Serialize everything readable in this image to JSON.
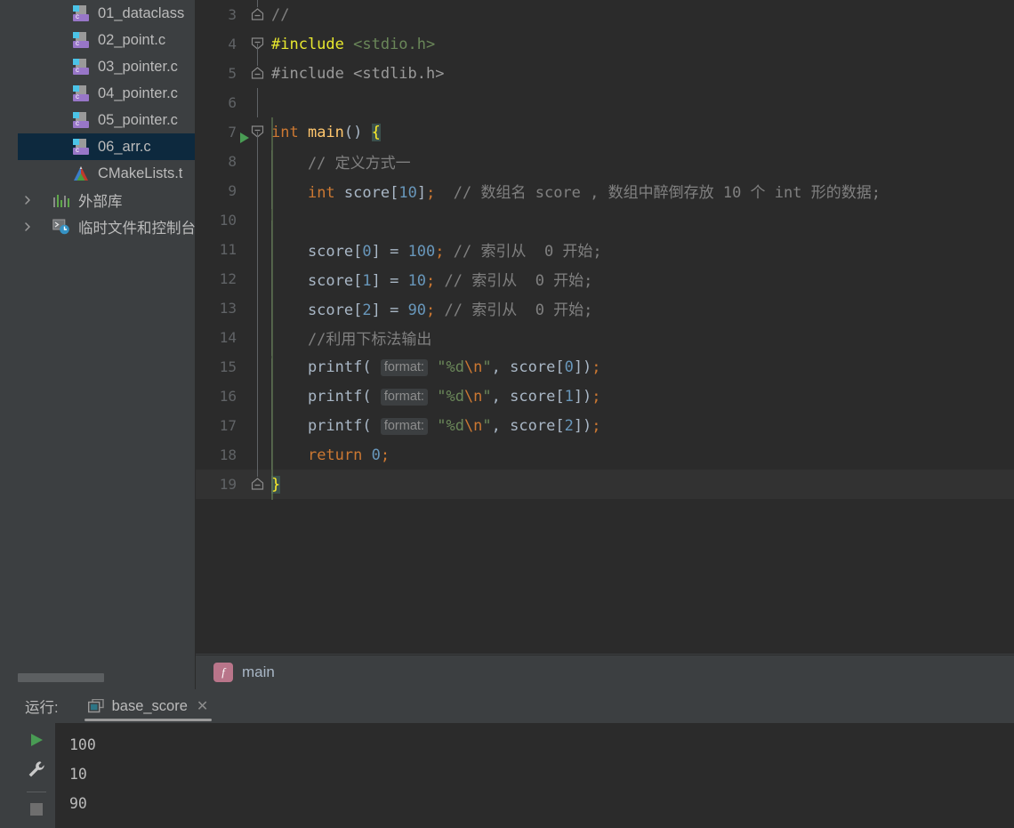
{
  "project_tree": {
    "name": "project-tree",
    "items": [
      {
        "label": "01_dataclass",
        "icon": "c-file-icon",
        "type": "file",
        "selected": false,
        "indent": "file"
      },
      {
        "label": "02_point.c",
        "icon": "c-file-icon",
        "type": "file",
        "selected": false,
        "indent": "file"
      },
      {
        "label": "03_pointer.c",
        "icon": "c-file-icon",
        "type": "file",
        "selected": false,
        "indent": "file"
      },
      {
        "label": "04_pointer.c",
        "icon": "c-file-icon",
        "type": "file",
        "selected": false,
        "indent": "file"
      },
      {
        "label": "05_pointer.c",
        "icon": "c-file-icon",
        "type": "file",
        "selected": false,
        "indent": "file"
      },
      {
        "label": "06_arr.c",
        "icon": "c-file-icon",
        "type": "file",
        "selected": true,
        "indent": "file"
      },
      {
        "label": "CMakeLists.t",
        "icon": "cmake-file-icon",
        "type": "file",
        "selected": false,
        "indent": "file"
      },
      {
        "label": "外部库",
        "icon": "external-libraries-icon",
        "type": "node",
        "selected": false,
        "indent": "node"
      },
      {
        "label": "临时文件和控制台",
        "icon": "scratches-consoles-icon",
        "type": "node",
        "selected": false,
        "indent": "node"
      }
    ],
    "selection_color": "#0d293e"
  },
  "editor": {
    "name": "code-editor",
    "first_visible_line": 3,
    "current_line": 19,
    "run_marker_line": 7,
    "lines": [
      {
        "num": "3",
        "segments": [
          {
            "t": "//",
            "c": "t-com"
          }
        ],
        "fold": "end",
        "indent": false
      },
      {
        "num": "4",
        "segments": [
          {
            "t": "#include ",
            "c": "t-inc-hl"
          },
          {
            "t": "<stdio.h>",
            "c": "t-hdr"
          }
        ],
        "fold": "start",
        "indent": false
      },
      {
        "num": "5",
        "segments": [
          {
            "t": "#include ",
            "c": "t-inc"
          },
          {
            "t": "<stdlib.h>",
            "c": "t-hdr-g"
          }
        ],
        "fold": "end",
        "indent": false
      },
      {
        "num": "6",
        "segments": [],
        "fold": "none",
        "indent": false
      },
      {
        "num": "7",
        "segments": [
          {
            "t": "int ",
            "c": "t-kw"
          },
          {
            "t": "main",
            "c": "t-fn"
          },
          {
            "t": "()",
            "c": "t-paren"
          },
          {
            "t": " ",
            "c": "t-def"
          },
          {
            "t": "{",
            "c": "t-brace-hl"
          }
        ],
        "fold": "start",
        "indent": false
      },
      {
        "num": "8",
        "segments": [
          {
            "t": "    // 定义方式一",
            "c": "t-com"
          }
        ],
        "fold": "none",
        "indent": true
      },
      {
        "num": "9",
        "segments": [
          {
            "t": "    ",
            "c": "t-def"
          },
          {
            "t": "int",
            "c": "t-kw"
          },
          {
            "t": " score[",
            "c": "t-def"
          },
          {
            "t": "10",
            "c": "t-num"
          },
          {
            "t": "]",
            "c": "t-def"
          },
          {
            "t": ";",
            "c": "t-esc"
          },
          {
            "t": "  // 数组名 score , 数组中醉倒存放 10 个 int 形的数据;",
            "c": "t-com"
          }
        ],
        "fold": "none",
        "indent": true
      },
      {
        "num": "10",
        "segments": [],
        "fold": "none",
        "indent": true
      },
      {
        "num": "11",
        "segments": [
          {
            "t": "    score[",
            "c": "t-def"
          },
          {
            "t": "0",
            "c": "t-num"
          },
          {
            "t": "] = ",
            "c": "t-def"
          },
          {
            "t": "100",
            "c": "t-num"
          },
          {
            "t": ";",
            "c": "t-esc"
          },
          {
            "t": " // 索引从  0 开始;",
            "c": "t-com"
          }
        ],
        "fold": "none",
        "indent": true
      },
      {
        "num": "12",
        "segments": [
          {
            "t": "    score[",
            "c": "t-def"
          },
          {
            "t": "1",
            "c": "t-num"
          },
          {
            "t": "] = ",
            "c": "t-def"
          },
          {
            "t": "10",
            "c": "t-num"
          },
          {
            "t": ";",
            "c": "t-esc"
          },
          {
            "t": " // 索引从  0 开始;",
            "c": "t-com"
          }
        ],
        "fold": "none",
        "indent": true
      },
      {
        "num": "13",
        "segments": [
          {
            "t": "    score[",
            "c": "t-def"
          },
          {
            "t": "2",
            "c": "t-num"
          },
          {
            "t": "] = ",
            "c": "t-def"
          },
          {
            "t": "90",
            "c": "t-num"
          },
          {
            "t": ";",
            "c": "t-esc"
          },
          {
            "t": " // 索引从  0 开始;",
            "c": "t-com"
          }
        ],
        "fold": "none",
        "indent": true
      },
      {
        "num": "14",
        "segments": [
          {
            "t": "    //利用下标法输出",
            "c": "t-com"
          }
        ],
        "fold": "none",
        "indent": true
      },
      {
        "num": "15",
        "segments": [
          {
            "t": "    printf(",
            "c": "t-def"
          },
          {
            "t": " ",
            "c": "t-def"
          },
          {
            "t": "format:",
            "c": "hint"
          },
          {
            "t": " ",
            "c": "t-def"
          },
          {
            "t": "\"%d",
            "c": "t-str"
          },
          {
            "t": "\\n",
            "c": "t-esc"
          },
          {
            "t": "\"",
            "c": "t-str"
          },
          {
            "t": ", score[",
            "c": "t-def"
          },
          {
            "t": "0",
            "c": "t-num"
          },
          {
            "t": "])",
            "c": "t-def"
          },
          {
            "t": ";",
            "c": "t-esc"
          }
        ],
        "fold": "none",
        "indent": true
      },
      {
        "num": "16",
        "segments": [
          {
            "t": "    printf(",
            "c": "t-def"
          },
          {
            "t": " ",
            "c": "t-def"
          },
          {
            "t": "format:",
            "c": "hint"
          },
          {
            "t": " ",
            "c": "t-def"
          },
          {
            "t": "\"%d",
            "c": "t-str"
          },
          {
            "t": "\\n",
            "c": "t-esc"
          },
          {
            "t": "\"",
            "c": "t-str"
          },
          {
            "t": ", score[",
            "c": "t-def"
          },
          {
            "t": "1",
            "c": "t-num"
          },
          {
            "t": "])",
            "c": "t-def"
          },
          {
            "t": ";",
            "c": "t-esc"
          }
        ],
        "fold": "none",
        "indent": true
      },
      {
        "num": "17",
        "segments": [
          {
            "t": "    printf(",
            "c": "t-def"
          },
          {
            "t": " ",
            "c": "t-def"
          },
          {
            "t": "format:",
            "c": "hint"
          },
          {
            "t": " ",
            "c": "t-def"
          },
          {
            "t": "\"%d",
            "c": "t-str"
          },
          {
            "t": "\\n",
            "c": "t-esc"
          },
          {
            "t": "\"",
            "c": "t-str"
          },
          {
            "t": ", score[",
            "c": "t-def"
          },
          {
            "t": "2",
            "c": "t-num"
          },
          {
            "t": "])",
            "c": "t-def"
          },
          {
            "t": ";",
            "c": "t-esc"
          }
        ],
        "fold": "none",
        "indent": true
      },
      {
        "num": "18",
        "segments": [
          {
            "t": "    ",
            "c": "t-def"
          },
          {
            "t": "return",
            "c": "t-kw"
          },
          {
            "t": " ",
            "c": "t-def"
          },
          {
            "t": "0",
            "c": "t-num"
          },
          {
            "t": ";",
            "c": "t-esc"
          }
        ],
        "fold": "none",
        "indent": true
      },
      {
        "num": "19",
        "segments": [
          {
            "t": "}",
            "c": "t-brace-hl"
          }
        ],
        "fold": "end",
        "indent": false
      }
    ]
  },
  "breadcrumb": {
    "name": "breadcrumb",
    "icon": "function-icon",
    "icon_glyph": "f",
    "label": "main"
  },
  "run_panel": {
    "name": "run-tool-window",
    "title": "运行:",
    "tab": {
      "icon": "run-configuration-icon",
      "label": "base_score",
      "close_glyph": "✕"
    },
    "toolbar": [
      {
        "name": "rerun-button",
        "icon": "play-icon",
        "color": "#499c54"
      },
      {
        "name": "settings-wrench-button",
        "icon": "wrench-icon",
        "color": "#c9c9c9"
      },
      {
        "name": "stop-button",
        "icon": "stop-square-icon",
        "color": "#6e6e6e"
      }
    ],
    "console_output": [
      "100",
      "10",
      "90"
    ]
  },
  "colors": {
    "editor_bg": "#2b2b2b",
    "panel_bg": "#3c3f41",
    "selection_blue": "#0d293e",
    "keyword_orange": "#cc7832",
    "string_green": "#6a8759",
    "number_blue": "#6897bb",
    "comment_gray": "#808080",
    "function_yellow": "#ffc66d",
    "text_default": "#a9b7c6",
    "run_green": "#499c54"
  }
}
